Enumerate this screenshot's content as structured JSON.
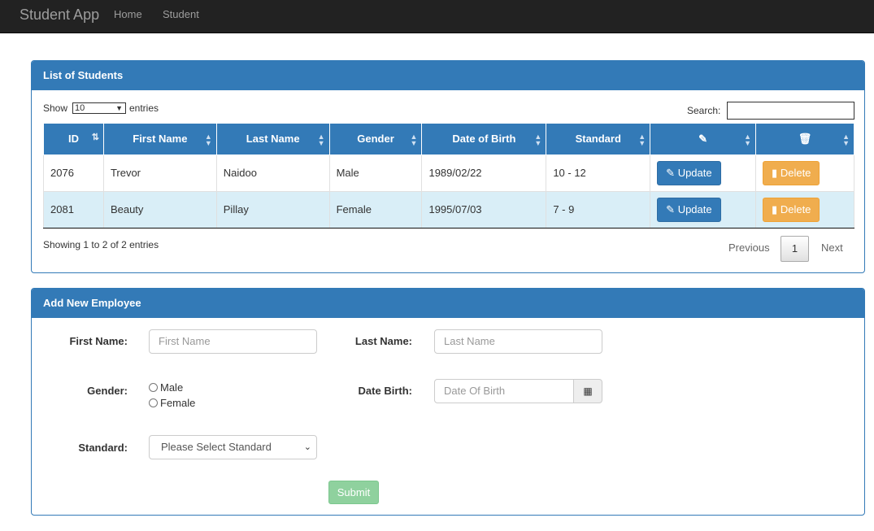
{
  "navbar": {
    "brand": "Student App",
    "links": [
      "Home",
      "Student"
    ]
  },
  "list_panel": {
    "title": "List of Students",
    "show_label": "Show",
    "page_size": "10",
    "entries_label": "entries",
    "search_label": "Search:",
    "search_value": "",
    "columns": [
      "ID",
      "First Name",
      "Last Name",
      "Gender",
      "Date of Birth",
      "Standard"
    ],
    "edit_column_icon": "edit-icon",
    "delete_column_icon": "trash-icon",
    "rows": [
      {
        "id": "2076",
        "first_name": "Trevor",
        "last_name": "Naidoo",
        "gender": "Male",
        "dob": "1989/02/22",
        "standard": "10 - 12",
        "update_label": "Update",
        "delete_label": "Delete"
      },
      {
        "id": "2081",
        "first_name": "Beauty",
        "last_name": "Pillay",
        "gender": "Female",
        "dob": "1995/07/03",
        "standard": "7 - 9",
        "update_label": "Update",
        "delete_label": "Delete"
      }
    ],
    "info": "Showing 1 to 2 of 2 entries",
    "pagination": {
      "previous": "Previous",
      "current_page": "1",
      "next": "Next"
    }
  },
  "form_panel": {
    "title": "Add New Employee",
    "first_name_label": "First Name:",
    "first_name_placeholder": "First Name",
    "last_name_label": "Last Name:",
    "last_name_placeholder": "Last Name",
    "gender_label": "Gender:",
    "gender_options": [
      "Male",
      "Female"
    ],
    "dob_label": "Date Birth:",
    "dob_placeholder": "Date Of Birth",
    "standard_label": "Standard:",
    "standard_selected": "Please Select Standard",
    "submit_label": "Submit"
  },
  "colors": {
    "primary": "#337ab7",
    "warning": "#f0ad4e",
    "submit_disabled": "#8fd19e",
    "navbar": "#222222",
    "row_alt": "#d9eef7"
  }
}
